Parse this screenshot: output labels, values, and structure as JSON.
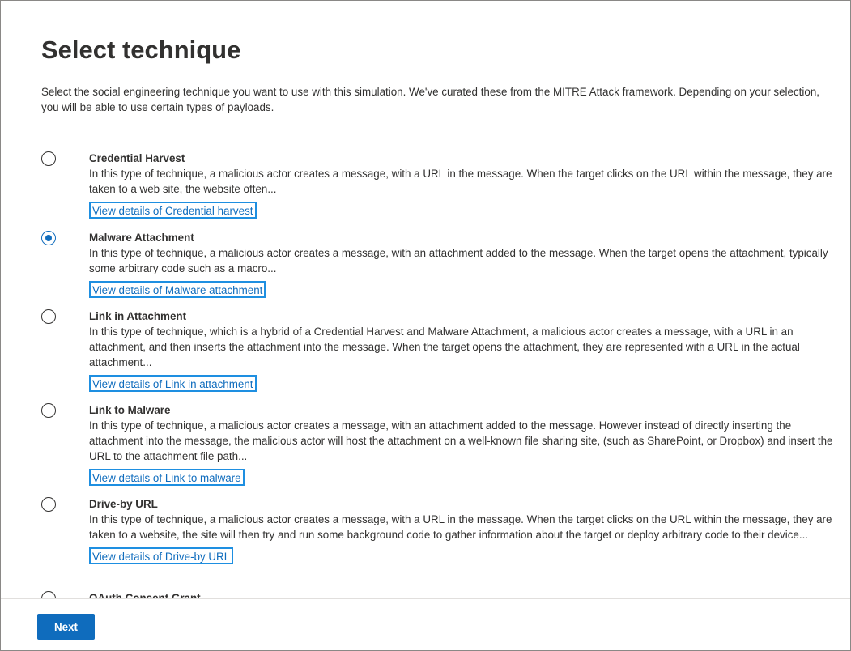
{
  "page": {
    "title": "Select technique",
    "intro": "Select the social engineering technique you want to use with this simulation. We've curated these from the MITRE Attack framework. Depending on your selection, you will be able to use certain types of payloads."
  },
  "techniques": [
    {
      "title": "Credential Harvest",
      "description": "In this type of technique, a malicious actor creates a message, with a URL in the message. When the target clicks on the URL within the message, they are taken to a web site, the website often...",
      "link": "View details of Credential harvest",
      "selected": false
    },
    {
      "title": "Malware Attachment",
      "description": "In this type of technique, a malicious actor creates a message, with an attachment added to the message. When the target opens the attachment, typically some arbitrary code such as a macro...",
      "link": "View details of Malware attachment",
      "selected": true
    },
    {
      "title": "Link in Attachment",
      "description": "In this type of technique, which is a hybrid of a Credential Harvest and Malware Attachment, a malicious actor creates a message, with a URL in an attachment, and then inserts the attachment into the message. When the target opens the attachment, they are represented with a URL in the actual attachment...",
      "link": "View details of Link in attachment",
      "selected": false
    },
    {
      "title": "Link to Malware",
      "description": "In this type of technique, a malicious actor creates a message, with an attachment added to the message. However instead of directly inserting the attachment into the message, the malicious actor will host the attachment on a well-known file sharing site, (such as SharePoint, or Dropbox) and insert the URL to the attachment file path...",
      "link": "View details of Link to malware",
      "selected": false
    },
    {
      "title": "Drive-by URL",
      "description": "In this type of technique, a malicious actor creates a message, with a URL in the message. When the target clicks on the URL within the message, they are taken to a website, the site will then try and run some background code to gather information about the target or deploy arbitrary code to their device...",
      "link": "View details of Drive-by URL",
      "selected": false
    },
    {
      "title": "OAuth Consent Grant",
      "selected": false
    }
  ],
  "footer": {
    "next_label": "Next"
  },
  "colors": {
    "accent": "#0f6cbd",
    "link_focus_border": "#1e8fe1",
    "text": "#323130"
  }
}
